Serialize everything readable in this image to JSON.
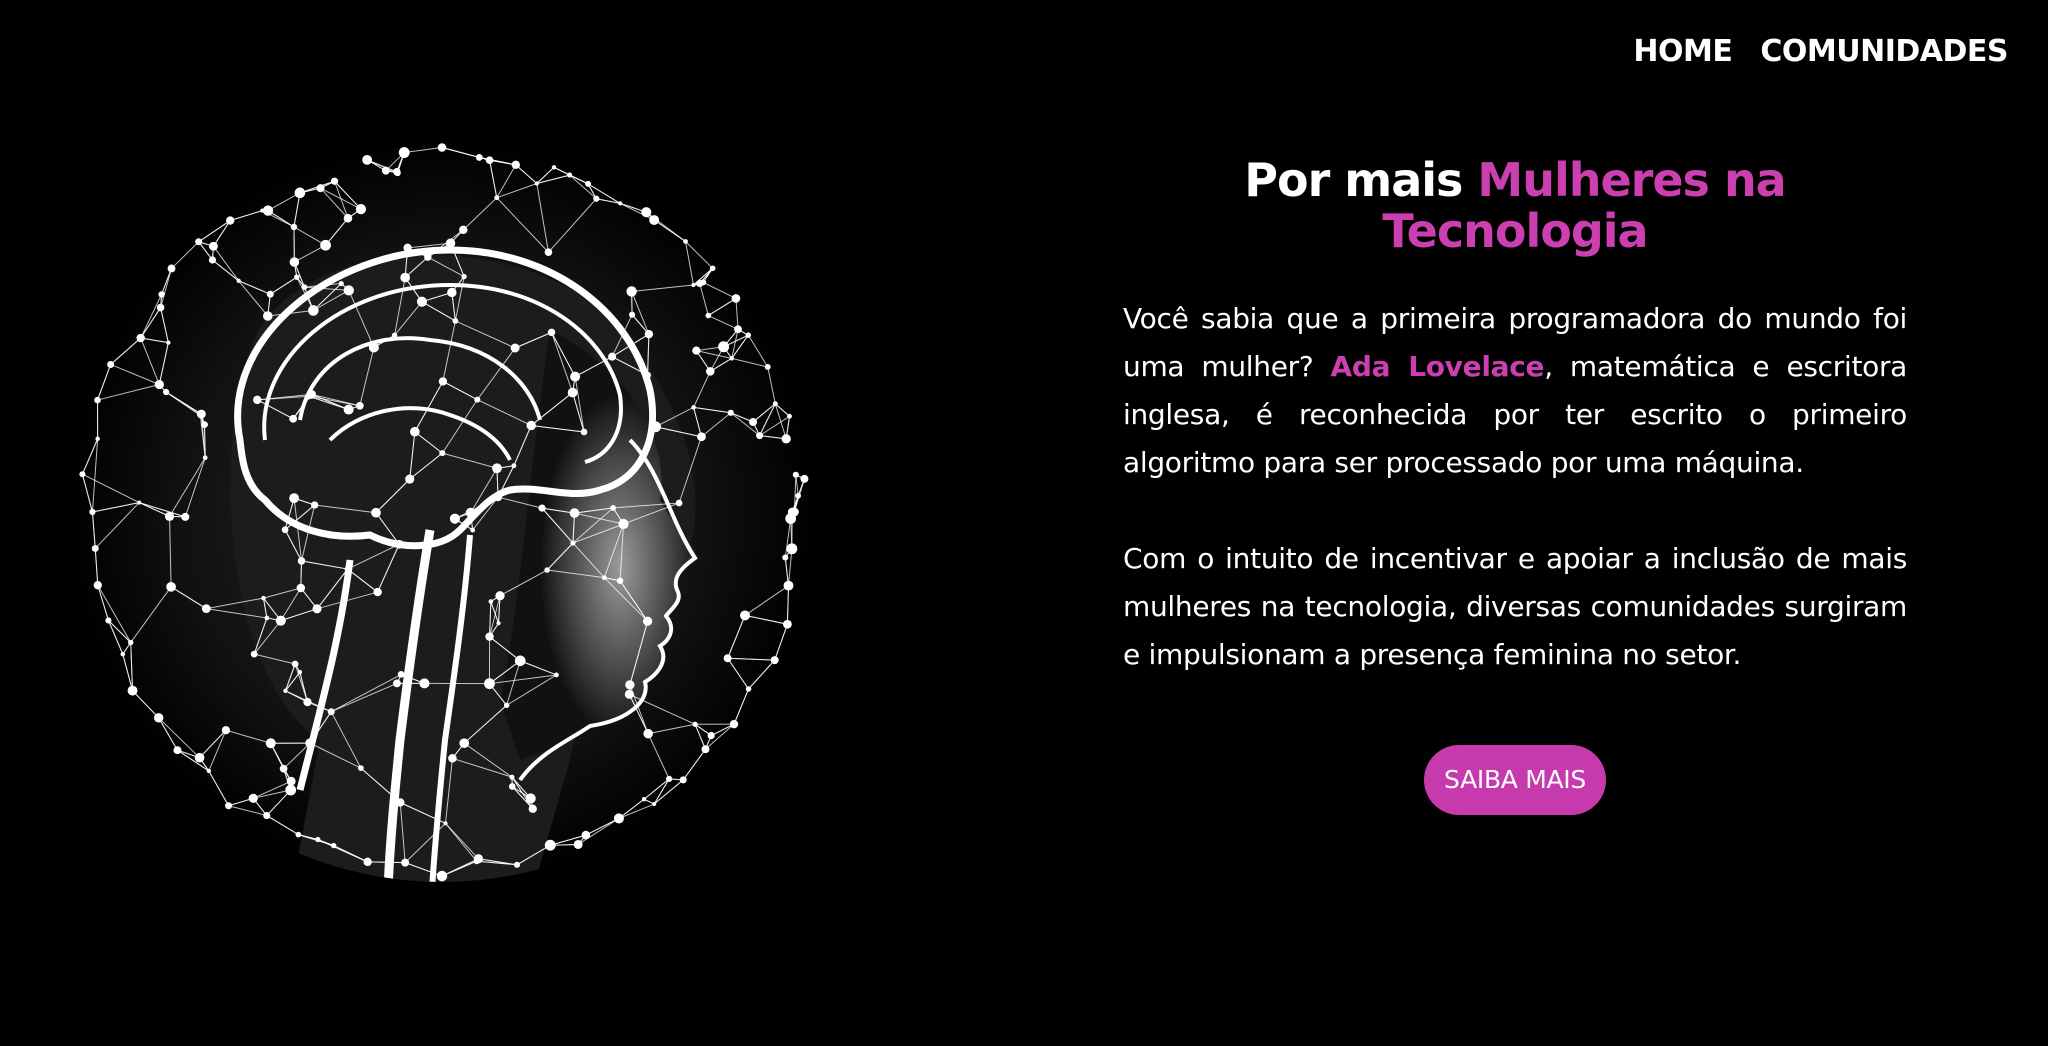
{
  "nav": {
    "home_label": "HOME",
    "comunidades_label": "COMUNIDADES"
  },
  "hero": {
    "title_prefix": "Por mais ",
    "title_accent": "Mulheres na Tecnologia",
    "paragraph1_before": "Você sabia que a primeira programadora do mundo foi uma mulher? ",
    "paragraph1_highlight": "Ada Lovelace",
    "paragraph1_after": ", matemática e escritora inglesa, é reconhecida por ter escrito o primeiro algoritmo para ser processado por uma máquina.",
    "paragraph2": "Com o intuito de incentivar e apoiar a inclusão de mais mulheres na tecnologia, diversas comunidades surgiram e impulsionam a presença feminina no setor.",
    "cta_label": "SAIBA MAIS"
  },
  "colors": {
    "background": "#000000",
    "text": "#ffffff",
    "accent": "#cc3fb0",
    "button": "#c73aae"
  },
  "icons": {
    "hero_image": "brain-network-sphere-woman-profile-illustration"
  }
}
